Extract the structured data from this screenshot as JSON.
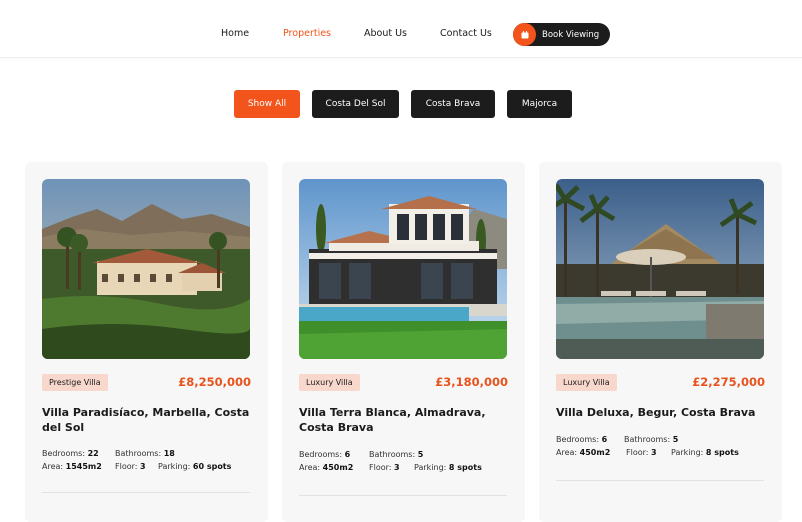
{
  "nav": {
    "items": [
      "Home",
      "Properties",
      "About Us",
      "Contact Us"
    ],
    "active": "Properties",
    "book_label": "Book Viewing"
  },
  "filters": [
    "Show All",
    "Costa Del Sol",
    "Costa Brava",
    "Majorca"
  ],
  "filter_active": "Show All",
  "colors": {
    "accent": "#f2541b",
    "dark": "#1c1c1c",
    "tag_bg": "#f8d7cc"
  },
  "properties": [
    {
      "tag": "Prestige Villa",
      "price": "£8,250,000",
      "title": "Villa Paradisíaco, Marbella, Costa del Sol",
      "bedrooms_label": "Bedrooms:",
      "bedrooms": "22",
      "bathrooms_label": "Bathrooms:",
      "bathrooms": "18",
      "area_label": "Area:",
      "area": "1545m2",
      "floor_label": "Floor:",
      "floor": "3",
      "parking_label": "Parking:",
      "parking": "60 spots"
    },
    {
      "tag": "Luxury Villa",
      "price": "£3,180,000",
      "title": "Villa Terra Blanca, Almadrava, Costa Brava",
      "bedrooms_label": "Bedrooms:",
      "bedrooms": "6",
      "bathrooms_label": "Bathrooms:",
      "bathrooms": "5",
      "area_label": "Area:",
      "area": "450m2",
      "floor_label": "Floor:",
      "floor": "3",
      "parking_label": "Parking:",
      "parking": "8 spots"
    },
    {
      "tag": "Luxury Villa",
      "price": "£2,275,000",
      "title": "Villa Deluxa, Begur, Costa Brava",
      "bedrooms_label": "Bedrooms:",
      "bedrooms": "6",
      "bathrooms_label": "Bathrooms:",
      "bathrooms": "5",
      "area_label": "Area:",
      "area": "450m2",
      "floor_label": "Floor:",
      "floor": "3",
      "parking_label": "Parking:",
      "parking": "8 spots"
    }
  ]
}
